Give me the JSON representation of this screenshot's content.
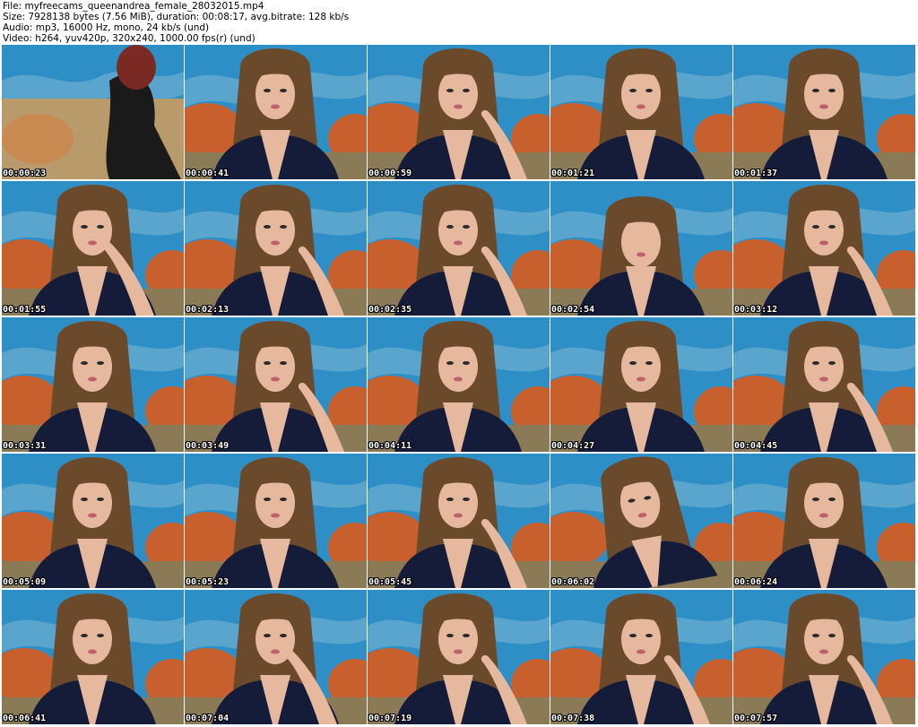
{
  "header": {
    "file_line": "File: myfreecams_queenandrea_female_28032015.mp4",
    "size_line": "Size: 7928138 bytes (7.56 MiB), duration: 00:08:17, avg.bitrate: 128 kb/s",
    "audio_line": "Audio: mp3, 16000 Hz, mono, 24 kb/s (und)",
    "video_line": "Video: h264, yuv420p, 320x240, 1000.00 fps(r) (und)"
  },
  "colors": {
    "background": "#ffffff",
    "wall_blue": "#2e8fc6",
    "couch_orange": "#c8602e",
    "hair_brown": "#6b4a2c",
    "dress_navy": "#151c3a",
    "skin": "#e6b89e"
  },
  "thumbnails": [
    {
      "timestamp": "00:00:23",
      "scene": "leaning-away"
    },
    {
      "timestamp": "00:00:41",
      "scene": "facing"
    },
    {
      "timestamp": "00:00:59",
      "scene": "hand-on-chin"
    },
    {
      "timestamp": "00:01:21",
      "scene": "facing"
    },
    {
      "timestamp": "00:01:37",
      "scene": "facing"
    },
    {
      "timestamp": "00:01:55",
      "scene": "hand-on-mouth"
    },
    {
      "timestamp": "00:02:13",
      "scene": "hand-on-cheek"
    },
    {
      "timestamp": "00:02:35",
      "scene": "hand-on-cheek"
    },
    {
      "timestamp": "00:02:54",
      "scene": "looking-down"
    },
    {
      "timestamp": "00:03:12",
      "scene": "hand-on-cheek"
    },
    {
      "timestamp": "00:03:31",
      "scene": "facing"
    },
    {
      "timestamp": "00:03:49",
      "scene": "hand-on-chin"
    },
    {
      "timestamp": "00:04:11",
      "scene": "facing"
    },
    {
      "timestamp": "00:04:27",
      "scene": "facing"
    },
    {
      "timestamp": "00:04:45",
      "scene": "hand-on-chin"
    },
    {
      "timestamp": "00:05:09",
      "scene": "facing"
    },
    {
      "timestamp": "00:05:23",
      "scene": "facing"
    },
    {
      "timestamp": "00:05:45",
      "scene": "hand-on-cheek"
    },
    {
      "timestamp": "00:06:02",
      "scene": "head-tilted"
    },
    {
      "timestamp": "00:06:24",
      "scene": "facing"
    },
    {
      "timestamp": "00:06:41",
      "scene": "facing"
    },
    {
      "timestamp": "00:07:04",
      "scene": "hand-on-mouth"
    },
    {
      "timestamp": "00:07:19",
      "scene": "hand-on-chin"
    },
    {
      "timestamp": "00:07:38",
      "scene": "hand-on-chin"
    },
    {
      "timestamp": "00:07:57",
      "scene": "hand-on-chin"
    }
  ]
}
